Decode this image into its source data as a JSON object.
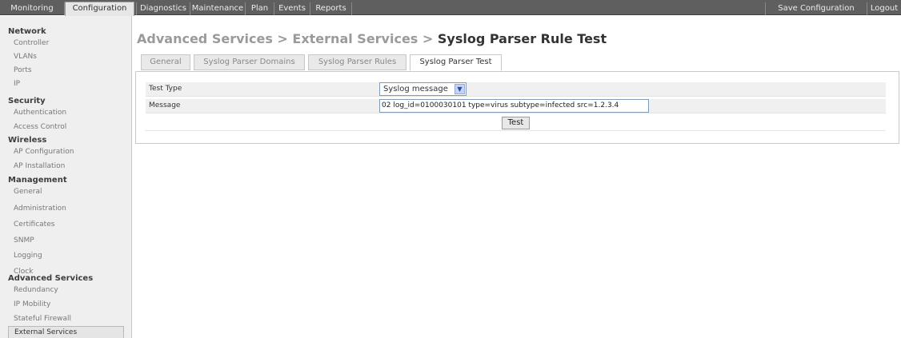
{
  "topnav": {
    "tabs": [
      "Monitoring",
      "Configuration",
      "Diagnostics",
      "Maintenance",
      "Plan",
      "Events",
      "Reports"
    ],
    "active": "Configuration",
    "save_label": "Save Configuration",
    "logout_label": "Logout"
  },
  "sidebar": {
    "sections": [
      {
        "title": "Network",
        "items": [
          "Controller",
          "VLANs",
          "Ports",
          "IP"
        ]
      },
      {
        "title": "Security",
        "items": [
          "Authentication",
          "Access Control"
        ]
      },
      {
        "title": "Wireless",
        "items": [
          "AP Configuration",
          "AP Installation"
        ]
      },
      {
        "title": "Management",
        "items": [
          "General",
          "Administration",
          "Certificates",
          "SNMP",
          "Logging",
          "Clock"
        ]
      },
      {
        "title": "Advanced Services",
        "items": [
          "Redundancy",
          "IP Mobility",
          "Stateful Firewall",
          "External Services"
        ]
      }
    ],
    "selected": "External Services"
  },
  "title": {
    "crumb1": "Advanced Services",
    "sep1": " > ",
    "crumb2": "External Services",
    "sep2": " > ",
    "current": "Syslog Parser Rule Test"
  },
  "subtabs": [
    "General",
    "Syslog Parser Domains",
    "Syslog Parser Rules",
    "Syslog Parser Test"
  ],
  "active_subtab": "Syslog Parser Test",
  "form": {
    "test_type_label": "Test Type",
    "test_type_value": "Syslog message",
    "message_label": "Message",
    "message_value": "02 log_id=0100030101 type=virus subtype=infected src=1.2.3.4",
    "test_button": "Test"
  }
}
